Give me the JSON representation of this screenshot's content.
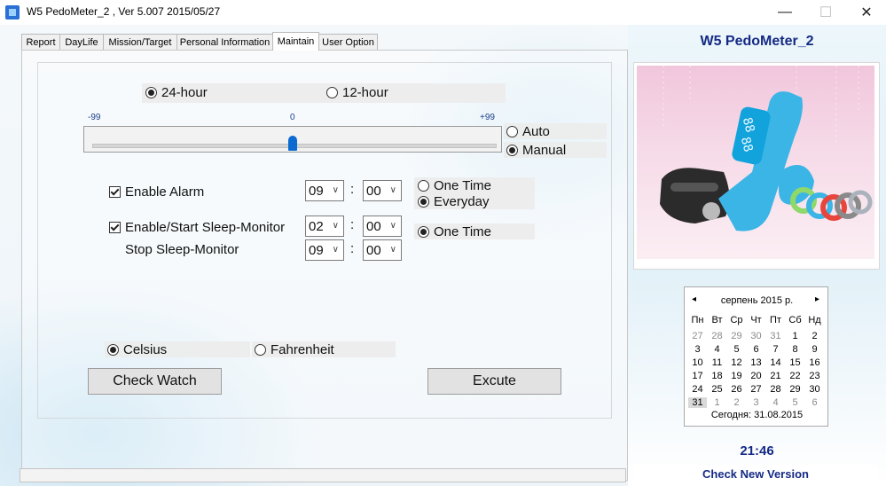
{
  "window": {
    "title": "W5  PedoMeter_2 , Ver 5.007  2015/05/27",
    "minimize_glyph": "—",
    "maximize_glyph": "☐",
    "close_glyph": "✕"
  },
  "tabs": [
    "Report",
    "DayLife",
    "Mission/Target",
    "Personal Information",
    "Maintain",
    "User Option"
  ],
  "active_tab": "Maintain",
  "time_format": {
    "h24_label": "24-hour",
    "h12_label": "12-hour",
    "selected": "24-hour"
  },
  "slider": {
    "min_label": "-99",
    "mid_label": "0",
    "max_label": "+99",
    "value": 0,
    "min": -99,
    "max": 99
  },
  "mode": {
    "auto_label": "Auto",
    "manual_label": "Manual",
    "selected": "Manual"
  },
  "alarm": {
    "label": "Enable Alarm",
    "checked": true,
    "hour": "09",
    "minute": "00",
    "one_time_label": "One Time",
    "everyday_label": "Everyday",
    "selected": "Everyday"
  },
  "sleep": {
    "start_label": "Enable/Start Sleep-Monitor",
    "checked": true,
    "start_hour": "02",
    "start_minute": "00",
    "stop_label": "Stop Sleep-Monitor",
    "stop_hour": "09",
    "stop_minute": "00",
    "one_time_label": "One Time",
    "selected": "One Time"
  },
  "time_separator": ":",
  "temperature": {
    "celsius_label": "Celsius",
    "fahrenheit_label": "Fahrenheit",
    "selected": "Celsius"
  },
  "buttons": {
    "check_watch": "Check Watch",
    "execute": "Excute"
  },
  "right": {
    "app_name": "W5  PedoMeter_2",
    "clock": "21:46",
    "check_version": "Check New Version"
  },
  "calendar": {
    "month_title": "серпень 2015 р.",
    "prev_glyph": "◂",
    "next_glyph": "▸",
    "weekdays": [
      "Пн",
      "Вт",
      "Ср",
      "Чт",
      "Пт",
      "Сб",
      "Нд"
    ],
    "weeks": [
      [
        "27",
        "28",
        "29",
        "30",
        "31",
        "1",
        "2"
      ],
      [
        "3",
        "4",
        "5",
        "6",
        "7",
        "8",
        "9"
      ],
      [
        "10",
        "11",
        "12",
        "13",
        "14",
        "15",
        "16"
      ],
      [
        "17",
        "18",
        "19",
        "20",
        "21",
        "22",
        "23"
      ],
      [
        "24",
        "25",
        "26",
        "27",
        "28",
        "29",
        "30"
      ],
      [
        "31",
        "1",
        "2",
        "3",
        "4",
        "5",
        "6"
      ]
    ],
    "today_label": "Сегодня: 31.08.2015",
    "today_day": "31"
  },
  "colors": {
    "accent_blue": "#152a85",
    "slider_thumb": "#0b6bd1",
    "band_blue": "#3bb5e6"
  }
}
